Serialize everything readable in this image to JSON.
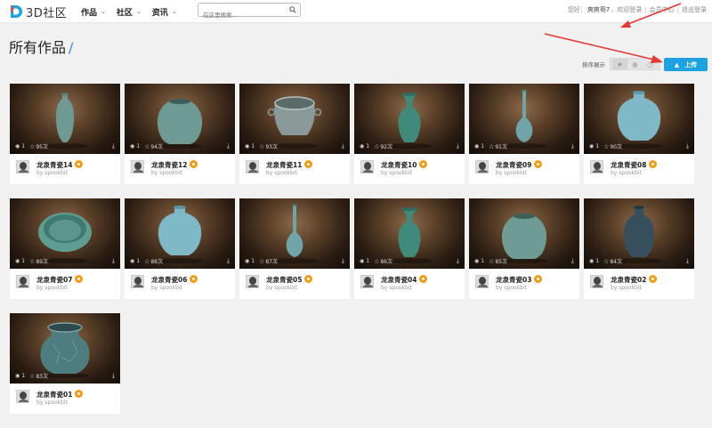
{
  "header": {
    "logo_text": "3D社区",
    "nav": [
      {
        "label": "作品",
        "name": "nav-works"
      },
      {
        "label": "社区",
        "name": "nav-community"
      },
      {
        "label": "资讯",
        "name": "nav-news"
      }
    ],
    "search_placeholder": "在这里搜索...",
    "greeting": "您好：",
    "username": "爽爽哥7",
    "welcome": "，欢迎登录",
    "member_center": "会员中心",
    "logout": "退出登录",
    "accent_color": "#1ca1e2"
  },
  "page": {
    "title": "所有作品",
    "title_suffix": "/",
    "sort_label": "排序展示",
    "upload_label": "上传"
  },
  "cards": [
    {
      "title": "龙泉青瓷14",
      "by": "by spookbit",
      "views": "1",
      "stars": "95次",
      "shape": "vase-tall"
    },
    {
      "title": "龙泉青瓷12",
      "by": "by spookbit",
      "views": "1",
      "stars": "94次",
      "shape": "jar-round"
    },
    {
      "title": "龙泉青瓷11",
      "by": "by spookbit",
      "views": "1",
      "stars": "93次",
      "shape": "bowl-handles"
    },
    {
      "title": "龙泉青瓷10",
      "by": "by spookbit",
      "views": "1",
      "stars": "92次",
      "shape": "vase-flared"
    },
    {
      "title": "龙泉青瓷09",
      "by": "by spookbit",
      "views": "1",
      "stars": "91次",
      "shape": "vase-slim"
    },
    {
      "title": "龙泉青瓷08",
      "by": "by spookbit",
      "views": "1",
      "stars": "90次",
      "shape": "jar-neck"
    },
    {
      "title": "龙泉青瓷07",
      "by": "by spookbit",
      "views": "1",
      "stars": "89次",
      "shape": "bowl-wide"
    },
    {
      "title": "龙泉青瓷06",
      "by": "by spookbit",
      "views": "1",
      "stars": "88次",
      "shape": "jar-neck"
    },
    {
      "title": "龙泉青瓷05",
      "by": "by spookbit",
      "views": "1",
      "stars": "87次",
      "shape": "vase-slim"
    },
    {
      "title": "龙泉青瓷04",
      "by": "by spookbit",
      "views": "1",
      "stars": "86次",
      "shape": "vase-flared"
    },
    {
      "title": "龙泉青瓷03",
      "by": "by spookbit",
      "views": "1",
      "stars": "85次",
      "shape": "jar-round"
    },
    {
      "title": "龙泉青瓷02",
      "by": "by spookbit",
      "views": "1",
      "stars": "84次",
      "shape": "vase-dark"
    },
    {
      "title": "龙泉青瓷01",
      "by": "by spookbit",
      "views": "1",
      "stars": "83次",
      "shape": "pot-crackle"
    }
  ]
}
